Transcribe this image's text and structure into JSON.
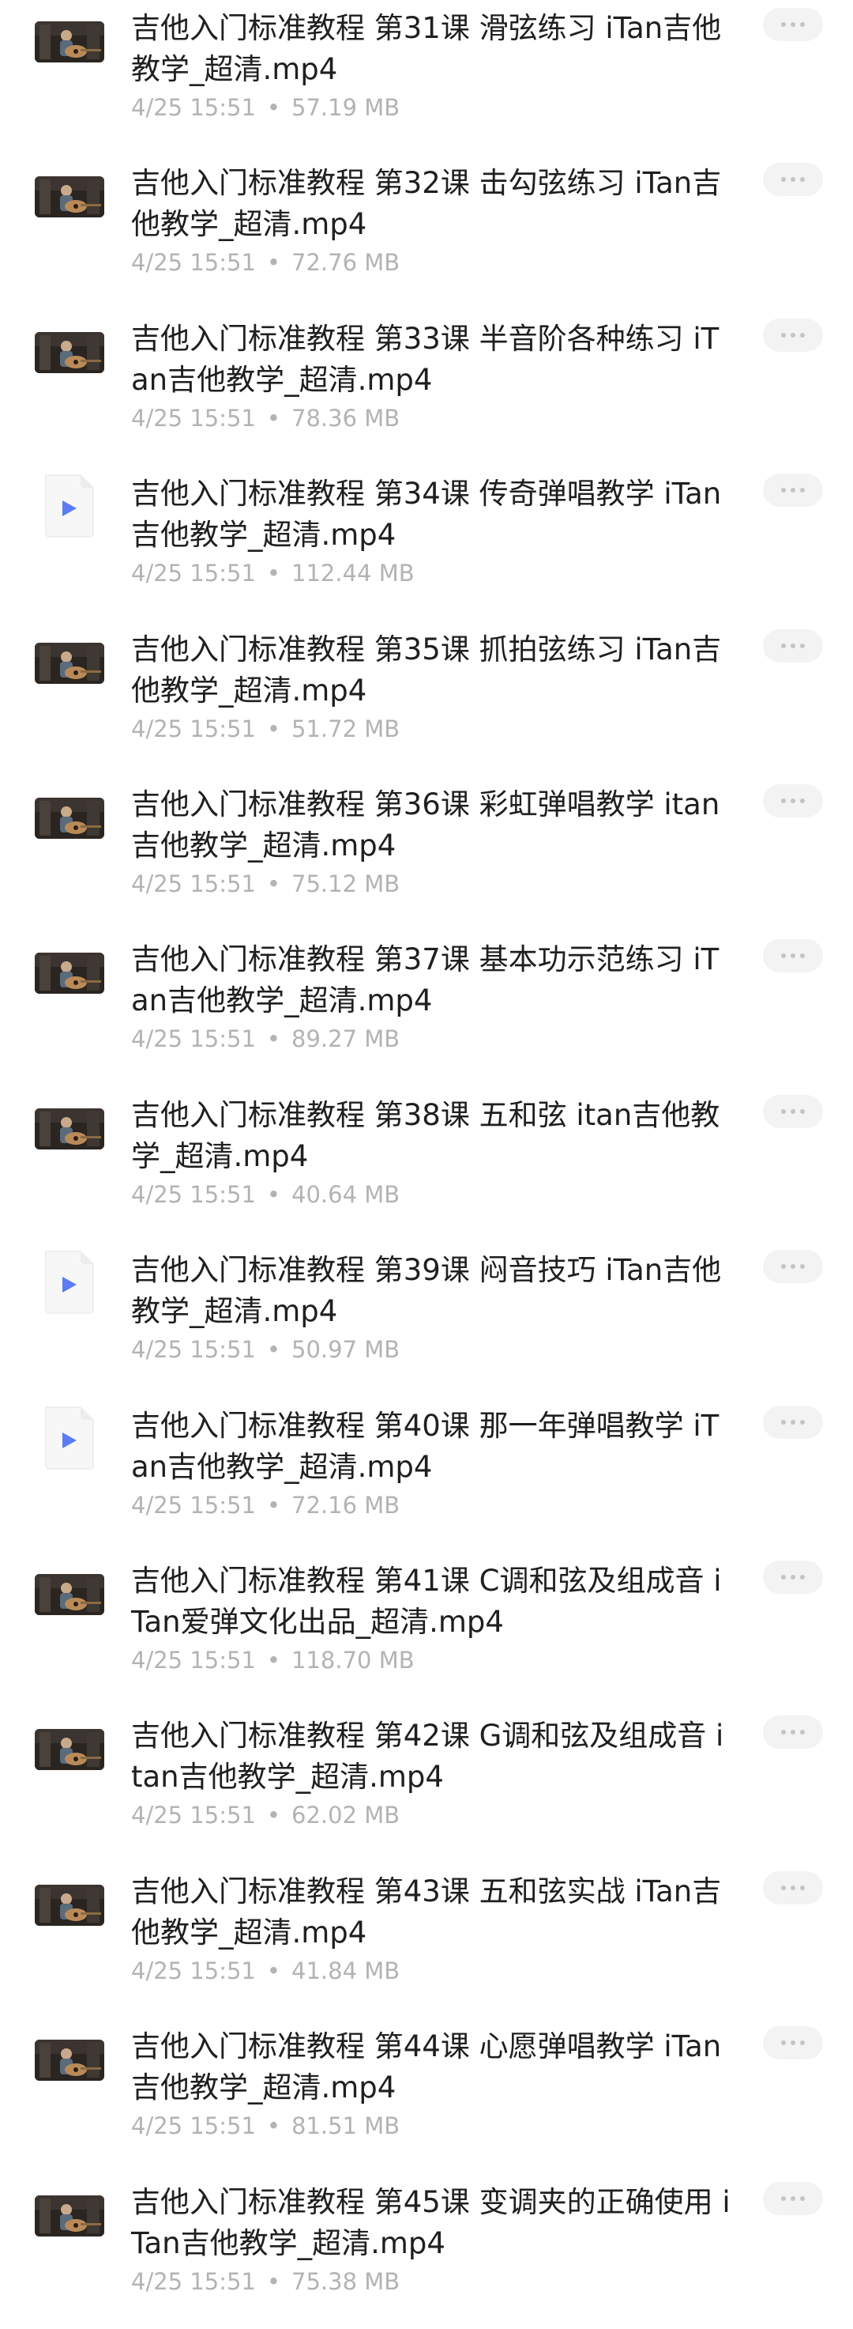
{
  "files": [
    {
      "name": "吉他入门标准教程 第31课 滑弦练习 iTan吉他教学_超清.mp4",
      "date": "4/25 15:51",
      "size": "57.19 MB",
      "icon": "video-thumbnail-icon"
    },
    {
      "name": "吉他入门标准教程 第32课 击勾弦练习 iTan吉他教学_超清.mp4",
      "date": "4/25 15:51",
      "size": "72.76 MB",
      "icon": "video-thumbnail-icon"
    },
    {
      "name": "吉他入门标准教程 第33课 半音阶各种练习 iTan吉他教学_超清.mp4",
      "date": "4/25 15:51",
      "size": "78.36 MB",
      "icon": "video-thumbnail-icon"
    },
    {
      "name": "吉他入门标准教程 第34课 传奇弹唱教学 iTan吉他教学_超清.mp4",
      "date": "4/25 15:51",
      "size": "112.44 MB",
      "icon": "video-file-icon"
    },
    {
      "name": "吉他入门标准教程 第35课 抓拍弦练习 iTan吉他教学_超清.mp4",
      "date": "4/25 15:51",
      "size": "51.72 MB",
      "icon": "video-thumbnail-icon"
    },
    {
      "name": "吉他入门标准教程 第36课 彩虹弹唱教学 itan吉他教学_超清.mp4",
      "date": "4/25 15:51",
      "size": "75.12 MB",
      "icon": "video-thumbnail-icon"
    },
    {
      "name": "吉他入门标准教程 第37课 基本功示范练习 iTan吉他教学_超清.mp4",
      "date": "4/25 15:51",
      "size": "89.27 MB",
      "icon": "video-thumbnail-icon"
    },
    {
      "name": "吉他入门标准教程 第38课 五和弦 itan吉他教学_超清.mp4",
      "date": "4/25 15:51",
      "size": "40.64 MB",
      "icon": "video-thumbnail-icon"
    },
    {
      "name": "吉他入门标准教程 第39课 闷音技巧 iTan吉他教学_超清.mp4",
      "date": "4/25 15:51",
      "size": "50.97 MB",
      "icon": "video-file-icon"
    },
    {
      "name": "吉他入门标准教程 第40课 那一年弹唱教学 iTan吉他教学_超清.mp4",
      "date": "4/25 15:51",
      "size": "72.16 MB",
      "icon": "video-file-icon"
    },
    {
      "name": "吉他入门标准教程 第41课 C调和弦及组成音 iTan爱弹文化出品_超清.mp4",
      "date": "4/25 15:51",
      "size": "118.70 MB",
      "icon": "video-thumbnail-icon"
    },
    {
      "name": "吉他入门标准教程 第42课 G调和弦及组成音 itan吉他教学_超清.mp4",
      "date": "4/25 15:51",
      "size": "62.02 MB",
      "icon": "video-thumbnail-icon"
    },
    {
      "name": "吉他入门标准教程 第43课 五和弦实战 iTan吉他教学_超清.mp4",
      "date": "4/25 15:51",
      "size": "41.84 MB",
      "icon": "video-thumbnail-icon"
    },
    {
      "name": "吉他入门标准教程 第44课 心愿弹唱教学 iTan吉他教学_超清.mp4",
      "date": "4/25 15:51",
      "size": "81.51 MB",
      "icon": "video-thumbnail-icon"
    },
    {
      "name": "吉他入门标准教程 第45课 变调夹的正确使用 iTan吉他教学_超清.mp4",
      "date": "4/25 15:51",
      "size": "75.38 MB",
      "icon": "video-thumbnail-icon"
    }
  ],
  "meta_separator": "•",
  "more_icon": "more-horizontal-icon",
  "colors": {
    "title": "#1f1f1f",
    "meta": "#b3b3b3",
    "more_button_bg": "#f3f3f3",
    "play_accent": "#5b7cf5",
    "thumbnail_dark": "#1e1b18"
  }
}
